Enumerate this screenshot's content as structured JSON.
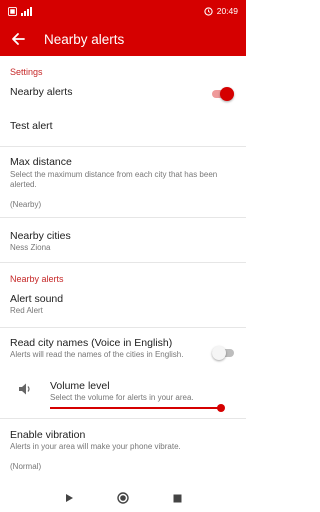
{
  "status": {
    "left": "📶",
    "battery": "🔋",
    "time": "20:49",
    "accent": "#d50000"
  },
  "app_bar": {
    "title": "Nearby alerts"
  },
  "settings": {
    "category": "Settings",
    "nearby_alerts": {
      "title": "Nearby alerts",
      "checked": true
    },
    "test_alert": {
      "title": "Test alert"
    },
    "max_distance": {
      "title": "Max distance",
      "summary": "Select the maximum distance from each city that has been alerted.",
      "value": "(Nearby)"
    },
    "nearby_cities": {
      "title": "Nearby cities",
      "value": "Ness Ziona"
    }
  },
  "nearby_section": {
    "category": "Nearby alerts",
    "alert_sound": {
      "title": "Alert sound",
      "value": "Red Alert"
    },
    "read_city_names": {
      "title": "Read city names (Voice in English)",
      "summary": "Alerts will read the names of the cities in English.",
      "checked": false
    },
    "volume": {
      "title": "Volume level",
      "summary": "Select the volume for alerts in your area.",
      "level": 1.0
    },
    "vibration": {
      "title": "Enable vibration",
      "summary": "Alerts in your area will make your phone vibrate.",
      "value": "(Normal)"
    }
  }
}
